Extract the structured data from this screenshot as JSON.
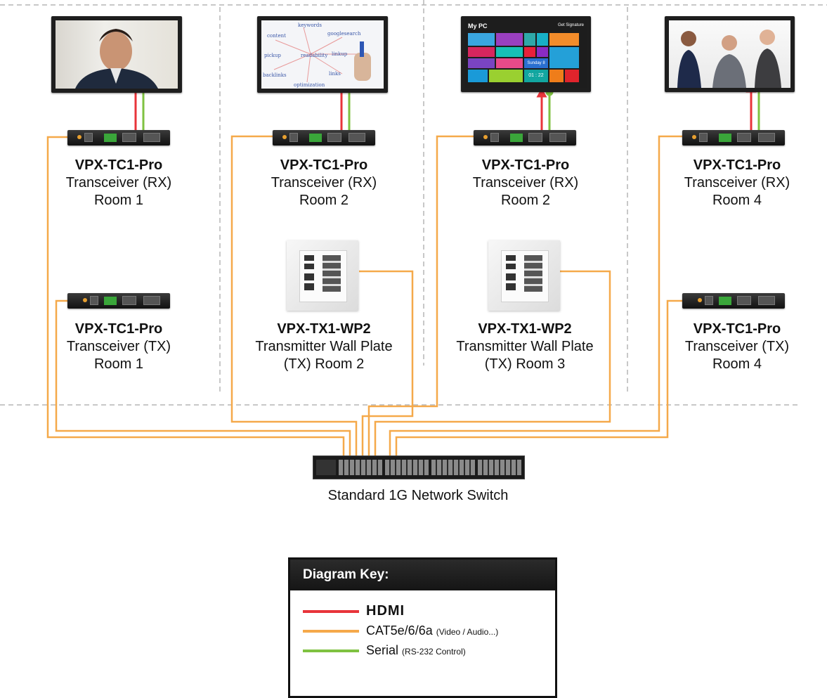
{
  "devices": {
    "rx1": {
      "model": "VPX-TC1-Pro",
      "line1": "Transceiver (RX)",
      "line2": "Room 1"
    },
    "rx2": {
      "model": "VPX-TC1-Pro",
      "line1": "Transceiver (RX)",
      "line2": "Room 2"
    },
    "rx3": {
      "model": "VPX-TC1-Pro",
      "line1": "Transceiver (RX)",
      "line2": "Room 2"
    },
    "rx4": {
      "model": "VPX-TC1-Pro",
      "line1": "Transceiver (RX)",
      "line2": "Room 4"
    },
    "tx1": {
      "model": "VPX-TC1-Pro",
      "line1": "Transceiver (TX)",
      "line2": "Room 1"
    },
    "wp2": {
      "model": "VPX-TX1-WP2",
      "line1": "Transmitter Wall Plate",
      "line2": "(TX) Room 2"
    },
    "wp3": {
      "model": "VPX-TX1-WP2",
      "line1": "Transmitter Wall Plate",
      "line2": "(TX) Room 3"
    },
    "tx4": {
      "model": "VPX-TC1-Pro",
      "line1": "Transceiver (TX)",
      "line2": "Room 4"
    }
  },
  "switch_label": "Standard 1G Network Switch",
  "screens": {
    "mypc_title": "My PC",
    "mypc_badge": "Get Signature",
    "mypc_day": "Sunday",
    "mypc_day_num": "8",
    "mypc_time": "01 : 22"
  },
  "whiteboard_words": [
    "keywords",
    "content",
    "googlesearch",
    "pickup",
    "linkup",
    "backlinks",
    "links",
    "readability",
    "optimization"
  ],
  "key": {
    "title": "Diagram Key:",
    "hdmi_label": "HDMI",
    "cat_label": "CAT5e/6/6a",
    "cat_note": "(Video / Audio...)",
    "serial_label": "Serial",
    "serial_note": "(RS-232 Control)"
  },
  "colors": {
    "hdmi": "#e8343a",
    "cat": "#f5a94a",
    "serial": "#7fc241",
    "divider": "#b5b5b5"
  }
}
